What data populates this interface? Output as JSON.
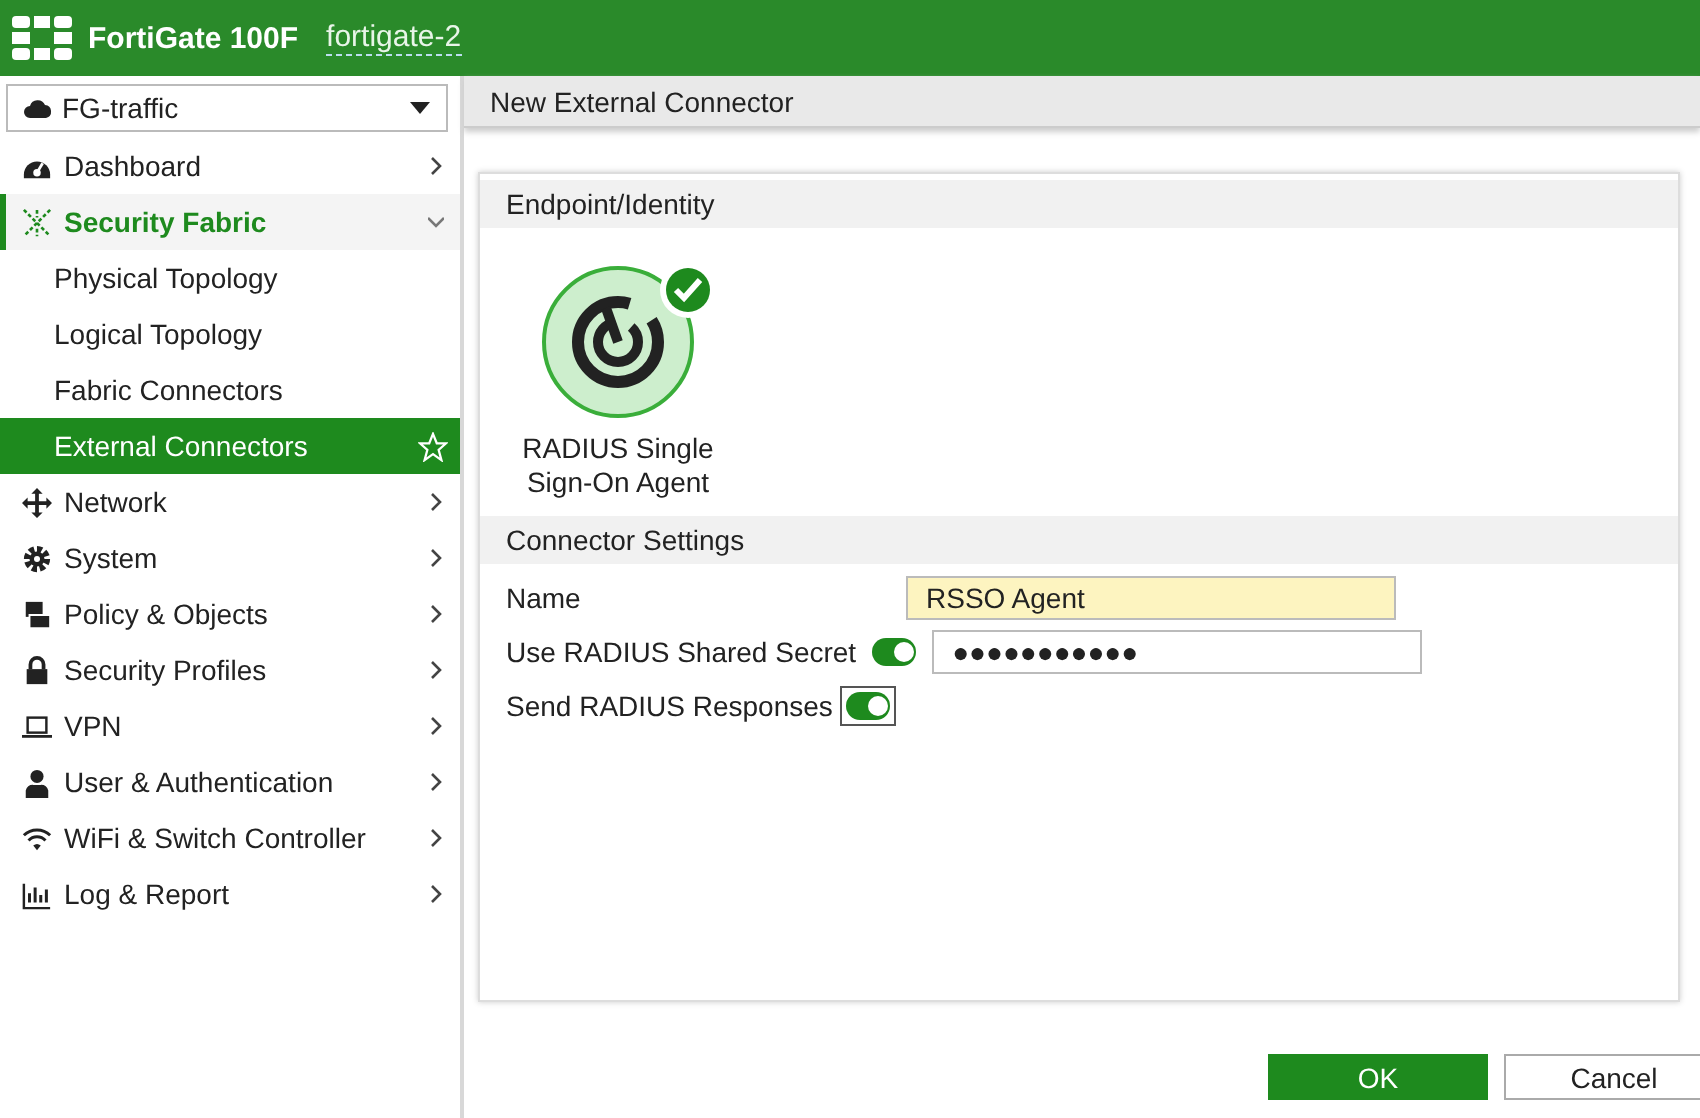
{
  "header": {
    "product": "FortiGate 100F",
    "hostname": "fortigate-2"
  },
  "vdom_select": {
    "value": "FG-traffic"
  },
  "sidebar": {
    "items": [
      {
        "label": "Dashboard",
        "expanded": false,
        "selected": false
      },
      {
        "label": "Security Fabric",
        "expanded": true,
        "selected": true,
        "children": [
          {
            "label": "Physical Topology",
            "selected": false
          },
          {
            "label": "Logical Topology",
            "selected": false
          },
          {
            "label": "Fabric Connectors",
            "selected": false
          },
          {
            "label": "External Connectors",
            "selected": true
          }
        ]
      },
      {
        "label": "Network",
        "expanded": false,
        "selected": false
      },
      {
        "label": "System",
        "expanded": false,
        "selected": false
      },
      {
        "label": "Policy & Objects",
        "expanded": false,
        "selected": false
      },
      {
        "label": "Security Profiles",
        "expanded": false,
        "selected": false
      },
      {
        "label": "VPN",
        "expanded": false,
        "selected": false
      },
      {
        "label": "User & Authentication",
        "expanded": false,
        "selected": false
      },
      {
        "label": "WiFi & Switch Controller",
        "expanded": false,
        "selected": false
      },
      {
        "label": "Log & Report",
        "expanded": false,
        "selected": false
      }
    ]
  },
  "page_title": "New External Connector",
  "endpoint_section": {
    "title": "Endpoint/Identity",
    "connector": {
      "label": "RADIUS Single Sign-On Agent",
      "selected": true
    }
  },
  "settings_section": {
    "title": "Connector Settings",
    "fields": [
      {
        "kind": "text",
        "label": "Name",
        "value": "RSSO Agent",
        "highlighted": true
      },
      {
        "kind": "toggle-text",
        "label": "Use RADIUS Shared Secret",
        "on": true,
        "focused": false,
        "value": "●●●●●●●●●●●",
        "highlighted": false
      },
      {
        "kind": "toggle",
        "label": "Send RADIUS Responses",
        "on": true,
        "focused": true
      }
    ]
  },
  "buttons": [
    {
      "label": "OK",
      "primary": true
    },
    {
      "label": "Cancel",
      "primary": false
    }
  ]
}
